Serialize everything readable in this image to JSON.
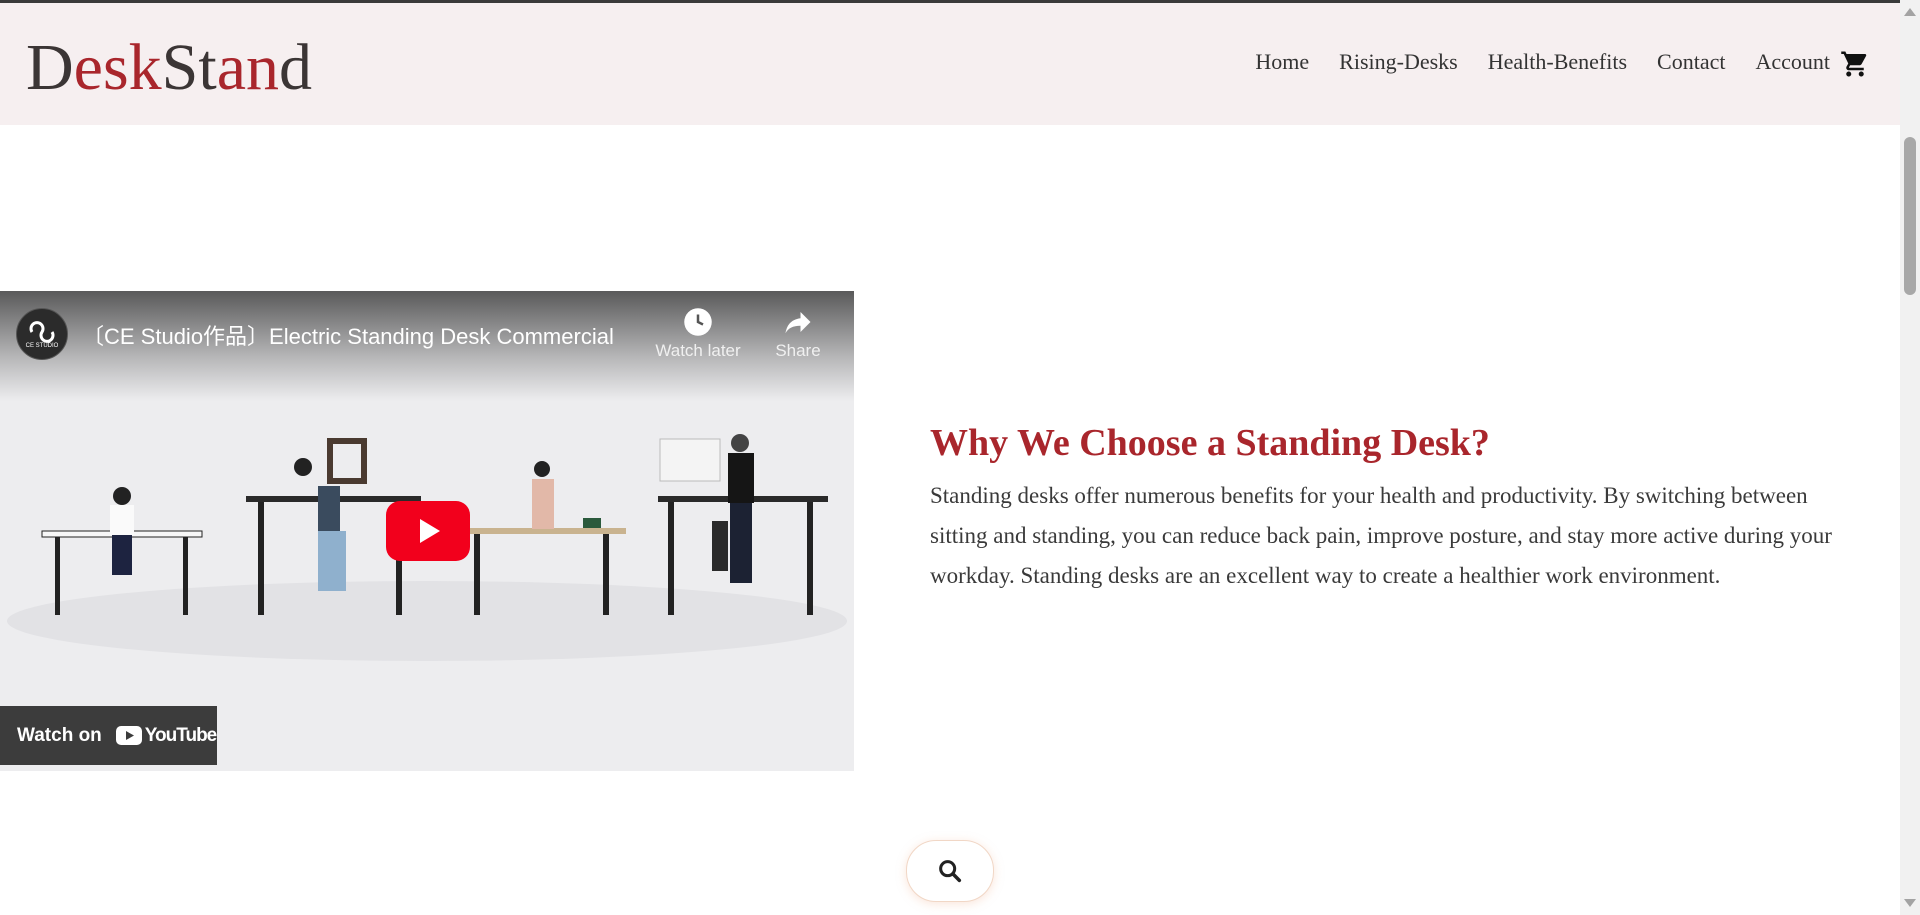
{
  "brand": {
    "logo_parts": [
      "D",
      "esk",
      "St",
      "an",
      "d"
    ]
  },
  "nav": {
    "items": [
      "Home",
      "Rising-Desks",
      "Health-Benefits",
      "Contact",
      "Account"
    ]
  },
  "video": {
    "title": "〔CE Studio作品〕Electric Standing Desk Commercial",
    "watch_later_label": "Watch later",
    "share_label": "Share",
    "watch_on_label": "Watch on",
    "youtube_word": "YouTube"
  },
  "section": {
    "heading": "Why We Choose a Standing Desk?",
    "body": "Standing desks offer numerous benefits for your health and productivity. By switching between sitting and standing, you can reduce back pain, improve posture, and stay more active during your workday. Standing desks are an excellent way to create a healthier work environment."
  },
  "colors": {
    "accent": "#a9262c",
    "header_bg": "#f6eff0",
    "text": "#333333"
  },
  "icons": {
    "cart": "cart-icon",
    "search": "search-icon",
    "play": "play-icon",
    "clock": "clock-icon",
    "share": "share-icon"
  }
}
